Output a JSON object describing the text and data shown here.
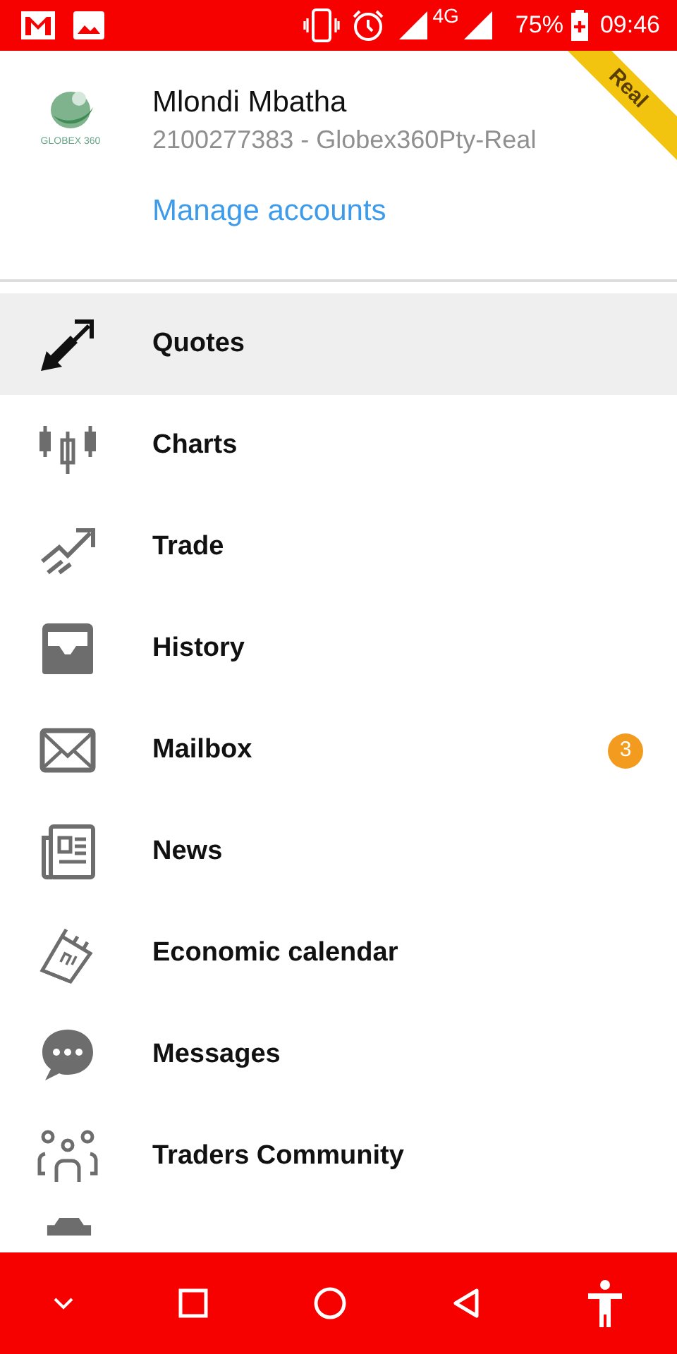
{
  "status_bar": {
    "network": "4G",
    "battery": "75%",
    "time": "09:46"
  },
  "account": {
    "name": "Mlondi Mbatha",
    "details": "2100277383 - Globex360Pty-Real",
    "logo_text": "GLOBEX 360",
    "ribbon": "Real",
    "manage_link": "Manage accounts"
  },
  "menu": [
    {
      "kind": "quotes",
      "label": "Quotes",
      "selected": true
    },
    {
      "kind": "charts",
      "label": "Charts",
      "selected": false
    },
    {
      "kind": "trade",
      "label": "Trade",
      "selected": false
    },
    {
      "kind": "history",
      "label": "History",
      "selected": false
    },
    {
      "kind": "mailbox",
      "label": "Mailbox",
      "selected": false,
      "badge": "3"
    },
    {
      "kind": "news",
      "label": "News",
      "selected": false
    },
    {
      "kind": "calendar",
      "label": "Economic calendar",
      "selected": false
    },
    {
      "kind": "messages",
      "label": "Messages",
      "selected": false
    },
    {
      "kind": "community",
      "label": "Traders Community",
      "selected": false
    }
  ]
}
